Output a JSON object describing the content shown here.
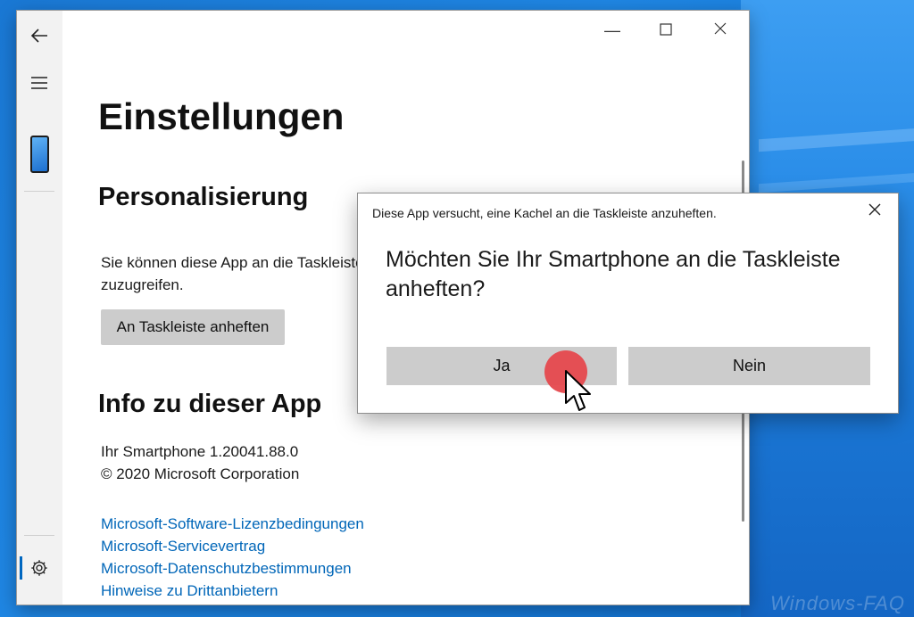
{
  "settings": {
    "title": "Einstellungen",
    "personalization": {
      "heading": "Personalisierung",
      "text_line1": "Sie können diese App an die Taskleiste",
      "text_line2": "zuzugreifen.",
      "pin_button": "An Taskleiste anheften"
    },
    "about": {
      "heading": "Info zu dieser App",
      "version": "Ihr Smartphone 1.20041.88.0",
      "copyright": "© 2020 Microsoft Corporation"
    },
    "links": [
      "Microsoft-Software-Lizenzbedingungen",
      "Microsoft-Servicevertrag",
      "Microsoft-Datenschutzbestimmungen",
      "Hinweise zu Drittanbietern"
    ]
  },
  "rail": {
    "icons": [
      "back-arrow-icon",
      "hamburger-menu-icon",
      "phone-icon",
      "gear-icon"
    ]
  },
  "window_controls": [
    "minimize-icon",
    "maximize-icon",
    "close-icon"
  ],
  "dialog": {
    "title": "Diese App versucht, eine Kachel an die Taskleiste anzuheften.",
    "question": "Möchten Sie Ihr Smartphone an die Taskleiste anheften?",
    "yes_button": "Ja",
    "no_button": "Nein"
  },
  "watermark": "Windows-FAQ",
  "colors": {
    "link": "#0066b8",
    "accent": "#0067c0",
    "click_indicator": "#e5484d",
    "desktop": "#1a78d4"
  }
}
